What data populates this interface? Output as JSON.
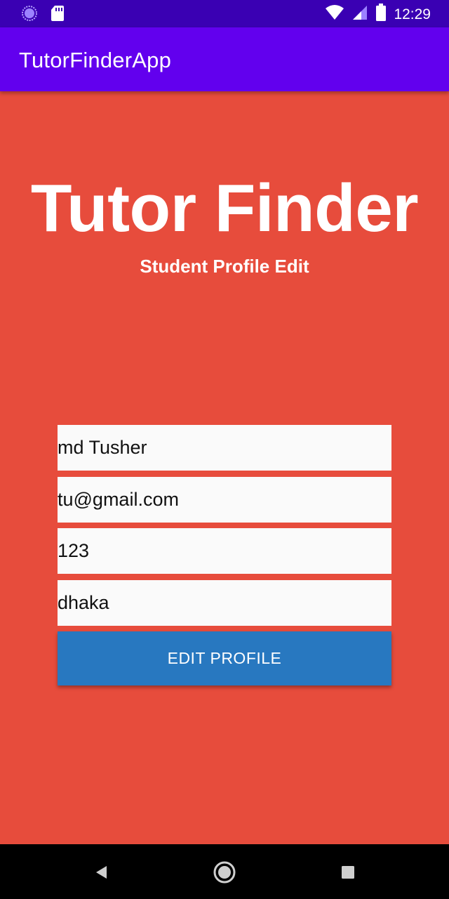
{
  "status_bar": {
    "time": "12:29",
    "icons": [
      "data-saver-icon",
      "sd-card-icon",
      "wifi-icon",
      "cell-signal-icon",
      "battery-icon"
    ]
  },
  "app_bar": {
    "title": "TutorFinderApp"
  },
  "hero": {
    "title": "Tutor Finder",
    "subtitle": "Student Profile Edit"
  },
  "form": {
    "name_value": "md Tusher",
    "email_value": "tu@gmail.com",
    "phone_value": "123",
    "address_value": "dhaka",
    "edit_button_label": "EDIT PROFILE"
  },
  "nav_bar": {
    "icons": [
      "back-icon",
      "home-icon",
      "recents-icon"
    ]
  },
  "colors": {
    "status_bar": "#3a00b3",
    "app_bar": "#6200ee",
    "background": "#e74c3c",
    "button": "#2878c0",
    "field": "#fafafa"
  }
}
